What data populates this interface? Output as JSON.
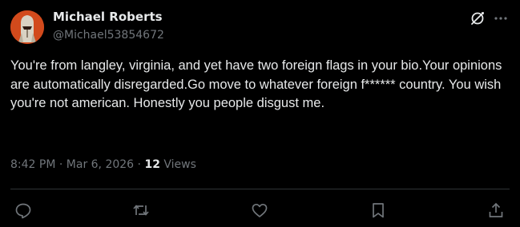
{
  "author": {
    "display_name": "Michael Roberts",
    "handle": "@Michael53854672",
    "avatar_icon": "armored-helmet-avatar",
    "avatar_color": "#d24a1c"
  },
  "header_icons": {
    "grok": "grok-icon",
    "more": "more-options-icon"
  },
  "post": {
    "text": "You're from langley, virginia, and yet have two foreign flags in your bio.Your opinions are automatically disregarded.Go move to whatever foreign f****** country. You wish you're not american. Honestly you people disgust me."
  },
  "meta": {
    "time": "8:42 PM",
    "separator1": " · ",
    "date": "Mar 6, 2026",
    "separator2": " · ",
    "views_count": "12",
    "views_label": " Views"
  },
  "actions": [
    "reply-icon",
    "repost-icon",
    "like-icon",
    "bookmark-icon",
    "share-icon"
  ],
  "colors": {
    "background": "#000000",
    "text": "#e7e9ea",
    "secondary": "#71767b",
    "divider": "#2f3336"
  }
}
